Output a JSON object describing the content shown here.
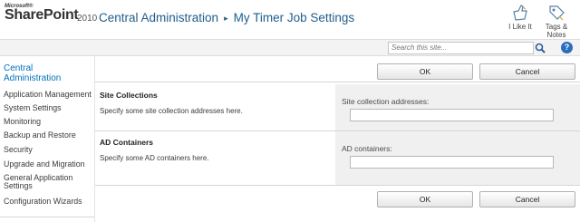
{
  "brand": {
    "microsoft": "Microsoft®",
    "product": "SharePoint",
    "version": "2010"
  },
  "header": {
    "breadcrumb_root": "Central Administration",
    "separator": "▸",
    "page_title": "My Timer Job Settings"
  },
  "social": {
    "like_label": "I Like It",
    "tags_label": "Tags & Notes"
  },
  "search": {
    "placeholder": "Search this site...",
    "help_label": "?"
  },
  "leftnav": {
    "heading": "Central Administration",
    "items": [
      "Application Management",
      "System Settings",
      "Monitoring",
      "Backup and Restore",
      "Security",
      "Upgrade and Migration",
      "General Application Settings",
      "Configuration Wizards"
    ]
  },
  "form": {
    "ok_label": "OK",
    "cancel_label": "Cancel",
    "sections": [
      {
        "title": "Site Collections",
        "description": "Specify some site collection addresses here.",
        "field_label": "Site collection addresses:",
        "value": ""
      },
      {
        "title": "AD Containers",
        "description": "Specify some AD containers here.",
        "field_label": "AD containers:",
        "value": ""
      }
    ]
  },
  "colors": {
    "accent": "#0072bc",
    "title": "#1f5d8c",
    "panel": "#f0f0f0"
  }
}
